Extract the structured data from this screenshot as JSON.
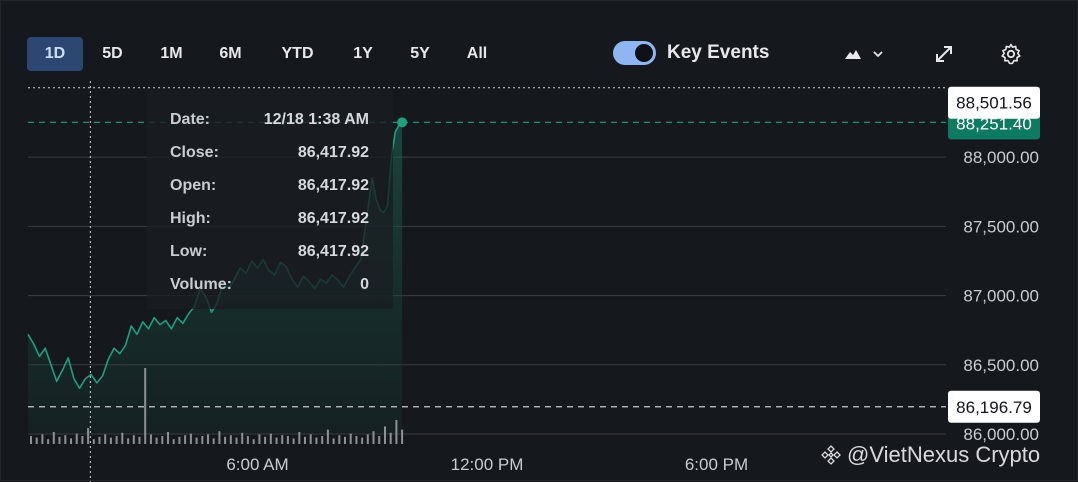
{
  "toolbar": {
    "ranges": [
      "1D",
      "5D",
      "1M",
      "6M",
      "YTD",
      "1Y",
      "5Y",
      "All"
    ],
    "active_range": "1D",
    "key_events_label": "Key Events",
    "key_events_on": true
  },
  "icons": {
    "chart_type": "mountain-icon",
    "chevron": "chevron-down-icon",
    "expand": "expand-icon",
    "settings": "gear-icon"
  },
  "tooltip": {
    "rows": [
      {
        "label": "Date:",
        "value": "12/18 1:38 AM"
      },
      {
        "label": "Close:",
        "value": "86,417.92"
      },
      {
        "label": "Open:",
        "value": "86,417.92"
      },
      {
        "label": "High:",
        "value": "86,417.92"
      },
      {
        "label": "Low:",
        "value": "86,417.92"
      },
      {
        "label": "Volume:",
        "value": "0"
      }
    ]
  },
  "watermark": "@VietNexus Crypto",
  "colors": {
    "line": "#1f9e80",
    "fill": "#1a5a4a",
    "grid": "#3a3d43",
    "price_badge": "#0f7a62",
    "active_tab": "#2c4772"
  },
  "chart_data": {
    "type": "area",
    "title": "",
    "xlabel": "",
    "ylabel": "",
    "ylim": [
      86000,
      88550
    ],
    "y_ticks": [
      86000,
      86500,
      87000,
      87500,
      88000
    ],
    "y_tick_labels": [
      "86,000.00",
      "86,500.00",
      "87,000.00",
      "87,500.00",
      "88,000.00"
    ],
    "x_range_hours": [
      0,
      24
    ],
    "x_ticks": [
      {
        "hour": 6,
        "label": "6:00 AM"
      },
      {
        "hour": 12,
        "label": "12:00 PM"
      },
      {
        "hour": 18,
        "label": "6:00 PM"
      }
    ],
    "crosshair": {
      "hour": 1.63,
      "price": 88501.56,
      "label": "88,501.56"
    },
    "last_price": {
      "price": 88251.4,
      "label": "88,251.40"
    },
    "reference_line": {
      "price": 86196.79,
      "label": "86,196.79"
    },
    "series": [
      {
        "points": [
          [
            0.0,
            86720
          ],
          [
            0.15,
            86650
          ],
          [
            0.3,
            86560
          ],
          [
            0.45,
            86620
          ],
          [
            0.6,
            86500
          ],
          [
            0.75,
            86380
          ],
          [
            0.9,
            86460
          ],
          [
            1.05,
            86550
          ],
          [
            1.2,
            86400
          ],
          [
            1.35,
            86330
          ],
          [
            1.5,
            86400
          ],
          [
            1.65,
            86430
          ],
          [
            1.8,
            86370
          ],
          [
            1.95,
            86420
          ],
          [
            2.1,
            86540
          ],
          [
            2.25,
            86620
          ],
          [
            2.4,
            86580
          ],
          [
            2.55,
            86640
          ],
          [
            2.7,
            86780
          ],
          [
            2.85,
            86720
          ],
          [
            3.0,
            86810
          ],
          [
            3.15,
            86760
          ],
          [
            3.3,
            86840
          ],
          [
            3.45,
            86790
          ],
          [
            3.6,
            86820
          ],
          [
            3.75,
            86760
          ],
          [
            3.9,
            86840
          ],
          [
            4.05,
            86800
          ],
          [
            4.2,
            86870
          ],
          [
            4.35,
            86920
          ],
          [
            4.5,
            87050
          ],
          [
            4.65,
            86990
          ],
          [
            4.8,
            86880
          ],
          [
            4.95,
            86950
          ],
          [
            5.1,
            87100
          ],
          [
            5.25,
            87050
          ],
          [
            5.4,
            87120
          ],
          [
            5.55,
            87200
          ],
          [
            5.7,
            87160
          ],
          [
            5.85,
            87250
          ],
          [
            6.0,
            87200
          ],
          [
            6.15,
            87260
          ],
          [
            6.3,
            87180
          ],
          [
            6.45,
            87150
          ],
          [
            6.6,
            87240
          ],
          [
            6.75,
            87210
          ],
          [
            6.9,
            87120
          ],
          [
            7.05,
            87060
          ],
          [
            7.2,
            87140
          ],
          [
            7.35,
            87100
          ],
          [
            7.5,
            87050
          ],
          [
            7.65,
            87120
          ],
          [
            7.8,
            87090
          ],
          [
            7.95,
            87150
          ],
          [
            8.1,
            87110
          ],
          [
            8.25,
            87060
          ],
          [
            8.4,
            87140
          ],
          [
            8.55,
            87200
          ],
          [
            8.7,
            87260
          ],
          [
            8.85,
            87550
          ],
          [
            9.0,
            87850
          ],
          [
            9.1,
            87700
          ],
          [
            9.2,
            87620
          ],
          [
            9.3,
            87600
          ],
          [
            9.4,
            87650
          ],
          [
            9.5,
            88000
          ],
          [
            9.6,
            88180
          ],
          [
            9.7,
            88230
          ],
          [
            9.78,
            88251.4
          ]
        ]
      }
    ],
    "volume": [
      0.1,
      0.08,
      0.12,
      0.06,
      0.15,
      0.09,
      0.11,
      0.07,
      0.13,
      0.1,
      0.2,
      0.06,
      0.09,
      0.12,
      0.08,
      0.1,
      0.14,
      0.07,
      0.11,
      0.09,
      0.95,
      0.12,
      0.08,
      0.1,
      0.15,
      0.06,
      0.09,
      0.11,
      0.13,
      0.08,
      0.1,
      0.12,
      0.07,
      0.16,
      0.09,
      0.11,
      0.08,
      0.14,
      0.1,
      0.06,
      0.12,
      0.09,
      0.13,
      0.08,
      0.11,
      0.1,
      0.07,
      0.15,
      0.09,
      0.12,
      0.08,
      0.1,
      0.18,
      0.07,
      0.11,
      0.09,
      0.13,
      0.1,
      0.08,
      0.12,
      0.16,
      0.1,
      0.22,
      0.14,
      0.3,
      0.18
    ]
  }
}
